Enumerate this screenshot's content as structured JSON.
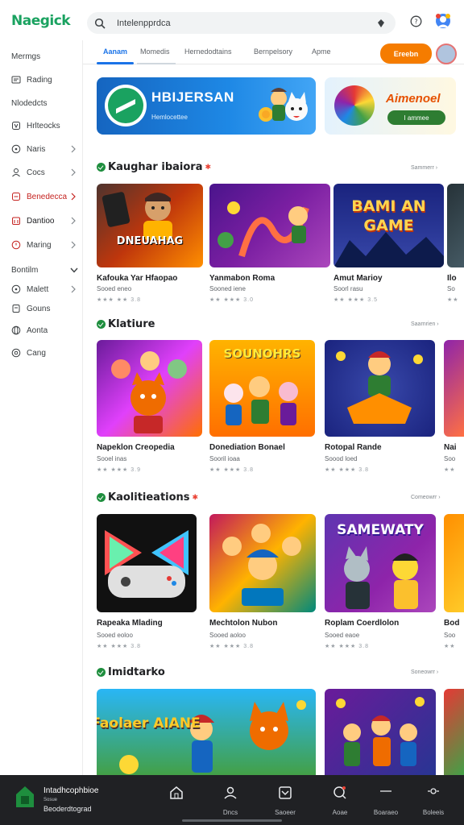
{
  "app": {
    "logo": "Naegick"
  },
  "search": {
    "value": "Intelenpprdca"
  },
  "sidebar": {
    "items": [
      {
        "label": "Mermgs"
      },
      {
        "label": "Rading"
      },
      {
        "label": "Nlodedcts"
      },
      {
        "label": "Hrlteocks"
      },
      {
        "label": "Naris"
      },
      {
        "label": "Cocs"
      },
      {
        "label": "Benedecca"
      },
      {
        "label": "Dantioo"
      },
      {
        "label": "Maring"
      }
    ],
    "section_label": "Bontilm",
    "sub_items": [
      {
        "label": "Malett"
      },
      {
        "label": "Gouns"
      },
      {
        "label": "Aonta"
      },
      {
        "label": "Cang"
      }
    ]
  },
  "tabs": [
    "Aanam",
    "Momedis",
    "Hernedodtains",
    "Bernpelsory",
    "Apme"
  ],
  "header": {
    "cta_label": "Ereebn"
  },
  "banners": [
    {
      "title": "HBIJERSAN",
      "subtitle": "Hemlocettee"
    },
    {
      "title": "Aimenoel",
      "button": "I ammee"
    }
  ],
  "sections": [
    {
      "title": "Kaughar ibaiora",
      "more": "Sammerr",
      "cards": [
        {
          "name": "Kafouka Yar Hfaopao",
          "sub": "Sooed eneo",
          "stars": "★★★ ★★ 3.8",
          "art": "DNEUAHAG"
        },
        {
          "name": "Yanmabon Roma",
          "sub": "Sooned iene",
          "stars": "★★ ★★★ 3.0",
          "art": ""
        },
        {
          "name": "Amut Marioy",
          "sub": "Soorl rasu",
          "stars": "★★ ★★★ 3.5",
          "art": "BAMI AN GAME"
        },
        {
          "name": "Ilo",
          "sub": "So",
          "stars": "★★",
          "art": ""
        }
      ]
    },
    {
      "title": "Klatiure",
      "more": "Saarnrien",
      "cards": [
        {
          "name": "Napeklon Creopedia",
          "sub": "Sooel inas",
          "stars": "★★ ★★★ 3.9",
          "art": ""
        },
        {
          "name": "Donediation Bonael",
          "sub": "Sooril ioaa",
          "stars": "★★ ★★★ 3.8",
          "art": "SOUNOHRS"
        },
        {
          "name": "Rotopal Rande",
          "sub": "Soood loed",
          "stars": "★★ ★★★ 3.8",
          "art": ""
        },
        {
          "name": "Nai",
          "sub": "Soo",
          "stars": "★★",
          "art": ""
        }
      ]
    },
    {
      "title": "Kaolitieations",
      "more": "Comeowrr",
      "cards": [
        {
          "name": "Rapeaka Mlading",
          "sub": "Sooed eoloo",
          "stars": "★★ ★★★ 3.8",
          "art": ""
        },
        {
          "name": "Mechtolon Nubon",
          "sub": "Sooed aoloo",
          "stars": "★★ ★★★ 3.8",
          "art": ""
        },
        {
          "name": "Roplam Coerdlolon",
          "sub": "Sooed eaoe",
          "stars": "★★ ★★★ 3.8",
          "art": "SAMEWATY"
        },
        {
          "name": "Bod",
          "sub": "Soo",
          "stars": "★★",
          "art": ""
        }
      ]
    },
    {
      "title": "Imidtarko",
      "more": "Soneowrr",
      "cards": [
        {
          "name": "",
          "sub": "",
          "stars": "",
          "art": "Faolaer AIANE"
        },
        {
          "name": "",
          "sub": "",
          "stars": "",
          "art": ""
        },
        {
          "name": "",
          "sub": "",
          "stars": "",
          "art": ""
        }
      ]
    }
  ],
  "bottom": {
    "app_title": "Intadhcophbioe",
    "app_meta": "Sosue",
    "app_sub": "Beoderdtograd",
    "nav": [
      "Dncs",
      "Saoeer",
      "Aoae",
      "Boaraeo",
      "Boleeis"
    ]
  },
  "colors": {
    "accent": "#1a73e8",
    "cta": "#f57c00",
    "brand": "#1aa260",
    "bottom_bar": "#202124"
  }
}
